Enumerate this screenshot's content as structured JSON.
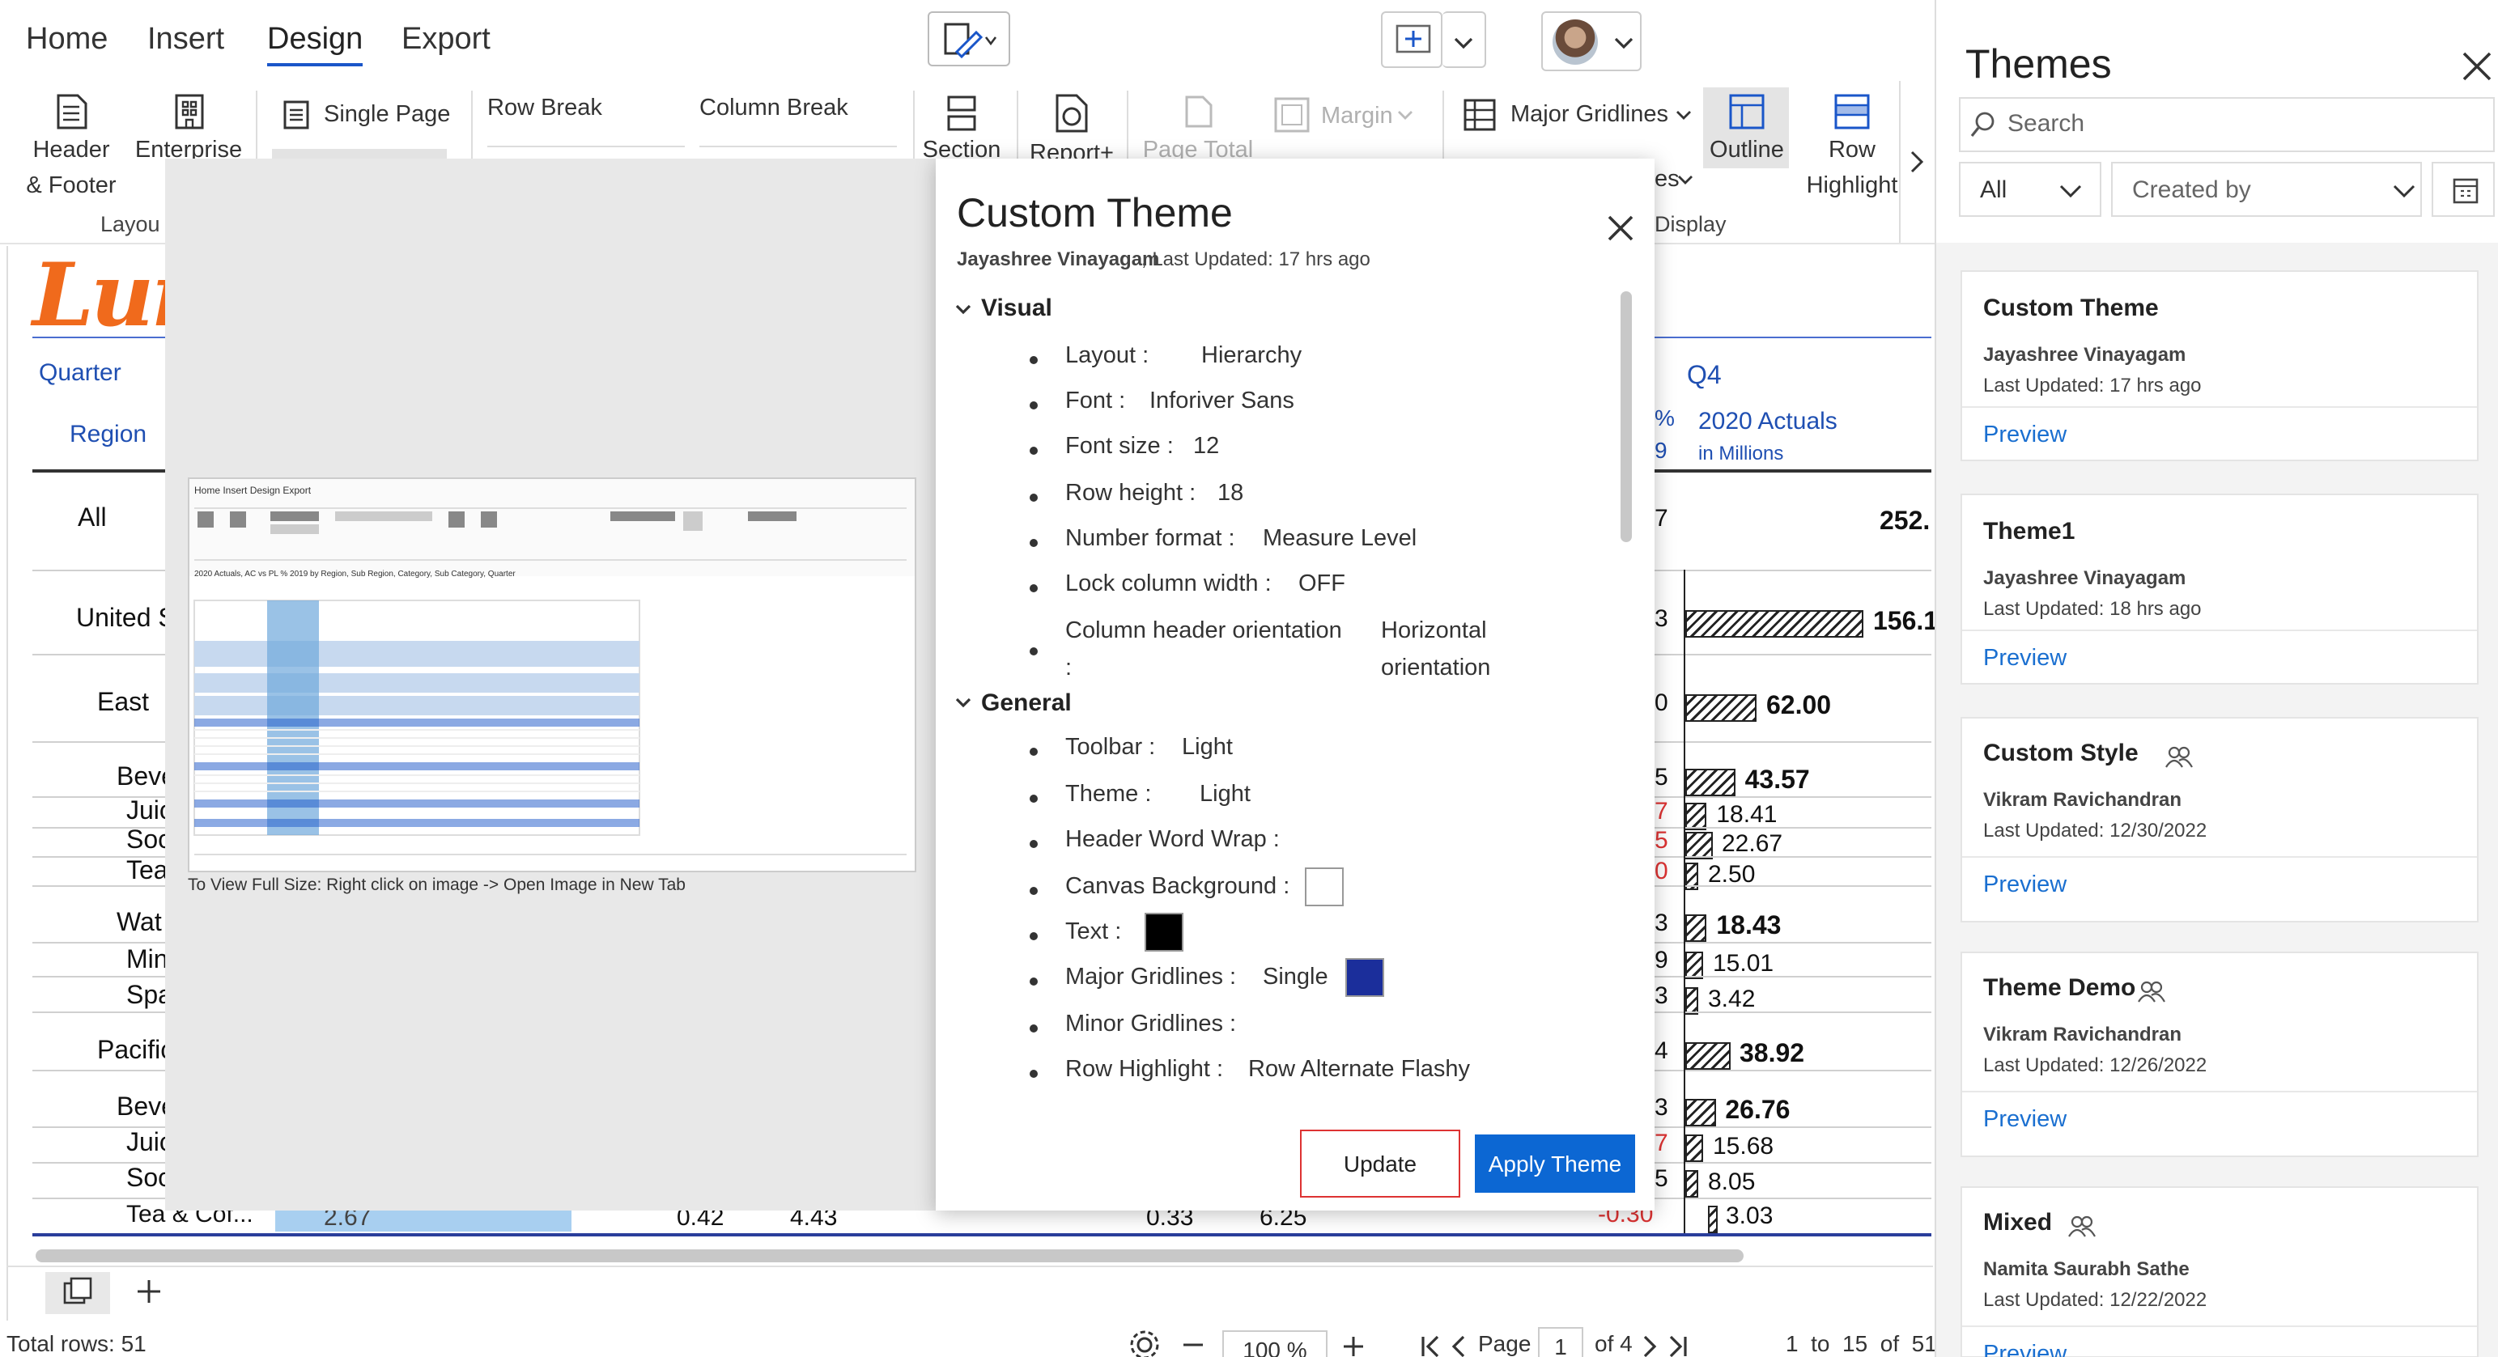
{
  "menu": {
    "tabs": [
      "Home",
      "Insert",
      "Design",
      "Export"
    ],
    "active": "Design"
  },
  "ribbon": {
    "header_footer": "Header\n& Footer",
    "enterprise": "Enterprise\nTh",
    "single_page": "Single Page",
    "row_break": "Row Break",
    "column_break": "Column Break",
    "section": "Section",
    "report": "Report+",
    "page_total": "Page Total",
    "margin": "Margin",
    "major_gridlines": "Major Gridlines",
    "outline": "Outline",
    "row_highlight": "Row\nHighlight",
    "styles_frag": "es",
    "group_layout": "Layou",
    "group_display": "Display"
  },
  "grid": {
    "logo": "Lum",
    "quarter": "Quarter",
    "region": "Region",
    "q4": "Q4",
    "q4_sub": "2020 Actuals",
    "q4_sub2": "in Millions",
    "rows": [
      {
        "label": "All",
        "ac": "7",
        "val": "252.",
        "bar": 0
      },
      {
        "label": "United S",
        "ac": "3",
        "val": "156.1",
        "bar": 1
      },
      {
        "label": "East",
        "ac": "0",
        "val": "62.00",
        "bar": 0.4
      },
      {
        "label": "Beve",
        "ac": "5",
        "val": "43.57",
        "bar": 0.28
      },
      {
        "label": "Juic",
        "ac": "7",
        "val": "18.41",
        "bar": 0.12
      },
      {
        "label": "Soc",
        "ac": "5",
        "val": "22.67",
        "bar": 0.15
      },
      {
        "label": "Tea",
        "ac": "0",
        "val": "2.50",
        "bar": 0.02
      },
      {
        "label": "Wat",
        "ac": "3",
        "val": "18.43",
        "bar": 0.12
      },
      {
        "label": "Min",
        "ac": "9",
        "val": "15.01",
        "bar": 0.1
      },
      {
        "label": "Spa",
        "ac": "3",
        "val": "3.42",
        "bar": 0.02
      },
      {
        "label": "Pacific",
        "ac": "4",
        "val": "38.92",
        "bar": 0.25
      },
      {
        "label": "Beve",
        "ac": "3",
        "val": "26.76",
        "bar": 0.17
      },
      {
        "label": "Juic",
        "ac": "7",
        "val": "15.68",
        "bar": 0.1
      },
      {
        "label": "Soc",
        "ac": "5",
        "val": "8.05",
        "bar": 0.05
      },
      {
        "label": "Tea & Cof...",
        "ac": "-0.30",
        "val": "3.03",
        "bar": 0.02
      }
    ],
    "last_row_vals": [
      "2.67",
      "0.42",
      "4.43",
      "0.33",
      "6.25"
    ]
  },
  "preview": {
    "caption": "To View Full Size: Right click on image -> Open Image in New Tab"
  },
  "dialog": {
    "title": "Custom Theme",
    "author": "Jayashree Vinayagam",
    "updated": ", Last Updated: 17 hrs ago",
    "visual_header": "Visual",
    "general_header": "General",
    "visual": [
      {
        "k": "Layout :",
        "v": "Hierarchy"
      },
      {
        "k": "Font :",
        "v": "Inforiver Sans"
      },
      {
        "k": "Font size :",
        "v": "12"
      },
      {
        "k": "Row height :",
        "v": "18"
      },
      {
        "k": "Number format :",
        "v": "Measure Level"
      },
      {
        "k": "Lock column width :",
        "v": "OFF"
      },
      {
        "k": "Column header orientation",
        "k2": ":",
        "v": "Horizontal",
        "v2": "orientation"
      }
    ],
    "general": [
      {
        "k": "Toolbar :",
        "v": "Light"
      },
      {
        "k": "Theme :",
        "v": "Light"
      },
      {
        "k": "Header Word Wrap :",
        "v": ""
      },
      {
        "k": "Canvas Background :",
        "v": "",
        "swatch": "#ffffff"
      },
      {
        "k": "Text :",
        "v": "",
        "swatch": "#000000"
      },
      {
        "k": "Major Gridlines :",
        "v": "Single",
        "swatch": "#1b2e9b"
      },
      {
        "k": "Minor Gridlines :",
        "v": ""
      },
      {
        "k": "Row Highlight :",
        "v": "Row Alternate Flashy"
      }
    ],
    "update_btn": "Update",
    "apply_btn": "Apply Theme"
  },
  "themes_panel": {
    "title": "Themes",
    "search_placeholder": "Search",
    "filter_all": "All",
    "filter_created": "Created by",
    "cards": [
      {
        "title": "Custom Theme",
        "author": "Jayashree Vinayagam",
        "updated": "Last Updated: 17 hrs ago",
        "shared": false,
        "preview": "Preview"
      },
      {
        "title": "Theme1",
        "author": "Jayashree Vinayagam",
        "updated": "Last Updated: 18 hrs ago",
        "shared": false,
        "preview": "Preview"
      },
      {
        "title": "Custom Style",
        "author": "Vikram Ravichandran",
        "updated": "Last Updated: 12/30/2022",
        "shared": true,
        "preview": "Preview"
      },
      {
        "title": "Theme Demo",
        "author": "Vikram Ravichandran",
        "updated": "Last Updated: 12/26/2022",
        "shared": true,
        "preview": "Preview"
      },
      {
        "title": "Mixed",
        "author": "Namita Saurabh Sathe",
        "updated": "Last Updated: 12/22/2022",
        "shared": true,
        "preview": "Preview"
      }
    ]
  },
  "status": {
    "total_rows": "Total rows: 51",
    "zoom": "100 %",
    "page_label": "Page",
    "page_num": "1",
    "page_of": "of 4",
    "range": "1  to  15  of  51"
  }
}
